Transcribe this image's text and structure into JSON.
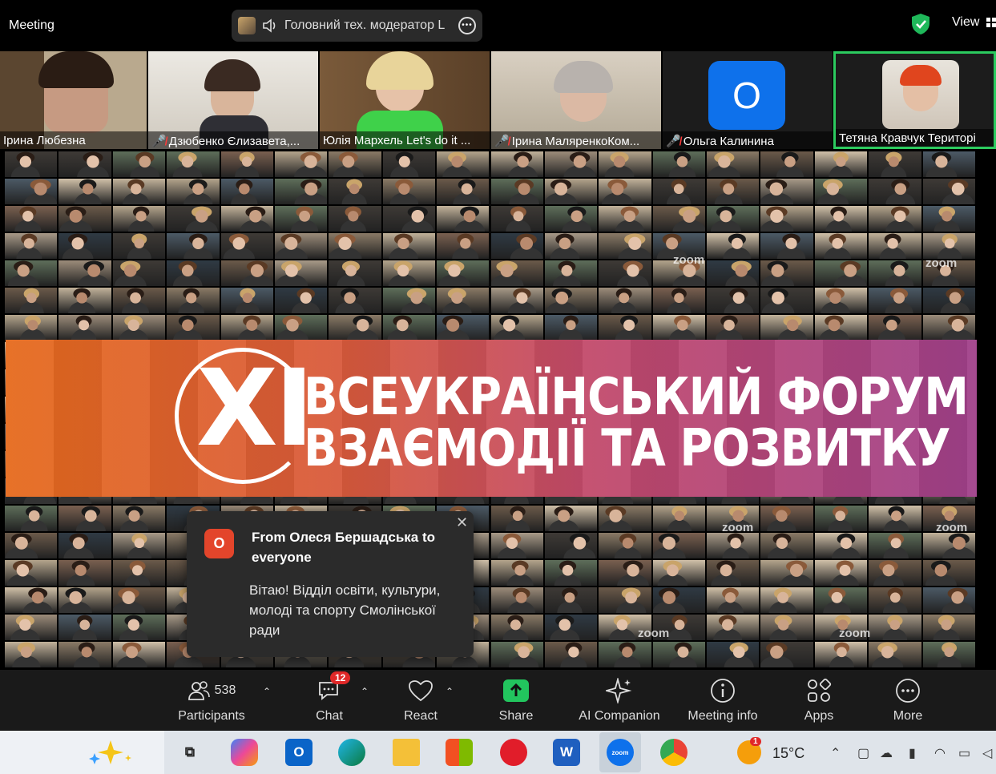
{
  "topbar": {
    "title": "Meeting",
    "speaker": "Головний тех. модератор L",
    "view_label": "View"
  },
  "strip": [
    {
      "name": "Ірина Любезна",
      "muted": false,
      "active": false
    },
    {
      "name": "Дзюбенко Єлизавета,...",
      "muted": true,
      "active": false
    },
    {
      "name": "Юлія Мархель Let's do it ...",
      "muted": false,
      "active": false
    },
    {
      "name": "Ірина МалярeнкоКом...",
      "muted": true,
      "active": false
    },
    {
      "name": "Ольга Калинина",
      "muted": true,
      "active": false,
      "avatar_letter": "O"
    },
    {
      "name": "Тетяна Кравчук Територі",
      "muted": false,
      "active": true
    }
  ],
  "banner": {
    "number": "XI",
    "line1": "ВСЕУКРАЇНСЬКИЙ ФОРУМ",
    "line2": "ВЗАЄМОДІЇ ТА РОЗВИТКУ"
  },
  "watermark": "zoom",
  "toast": {
    "avatar_letter": "O",
    "header": "From Олеся Бершадська to everyone",
    "message": "Вітаю! Відділ освіти, культури, молоді та спорту Смолінської ради",
    "close": "✕"
  },
  "toolbar": {
    "participants_label": "Participants",
    "participants_count": "538",
    "chat_label": "Chat",
    "chat_badge": "12",
    "react_label": "React",
    "share_label": "Share",
    "ai_label": "AI Companion",
    "info_label": "Meeting info",
    "apps_label": "Apps",
    "more_label": "More"
  },
  "taskbar": {
    "temperature": "15°C",
    "weather_badge": "1",
    "zoom_label": "zoom",
    "word_letter": "W"
  },
  "colors": {
    "active_border": "#2ccb5f",
    "toast_avatar": "#e3452b",
    "badge": "#e02828",
    "banner_start": "#e66a1d",
    "banner_end": "#a0408a"
  }
}
